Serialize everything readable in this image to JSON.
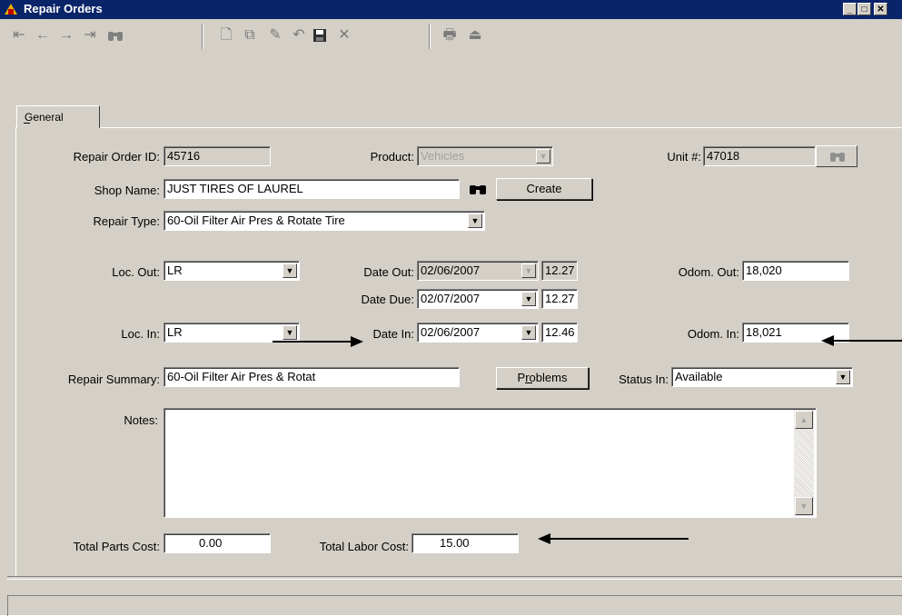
{
  "window": {
    "title": "Repair Orders"
  },
  "caption_buttons": {
    "minimize": "_",
    "maximize": "□",
    "close": "✕"
  },
  "toolbar": {
    "icons": [
      "first-record-icon",
      "previous-record-icon",
      "next-record-icon",
      "last-record-icon",
      "find-binoculars-icon",
      "new-record-icon",
      "copy-record-icon",
      "edit-pencil-icon",
      "undo-icon",
      "save-disk-icon",
      "delete-x-icon",
      "print-icon",
      "exit-icon"
    ]
  },
  "tabs": {
    "general": "General"
  },
  "form": {
    "repair_order_id": {
      "label": "Repair Order ID:",
      "value": "45716"
    },
    "product": {
      "label": "Product:",
      "value": "Vehicles"
    },
    "unit": {
      "label": "Unit #:",
      "value": "47018"
    },
    "shop_name": {
      "label": "Shop Name:",
      "value": "JUST TIRES OF LAUREL"
    },
    "create_button": "Create",
    "repair_type": {
      "label": "Repair Type:",
      "value": "60-Oil Filter Air Pres & Rotate Tire"
    },
    "loc_out": {
      "label": "Loc. Out:",
      "value": "LR"
    },
    "date_out": {
      "label": "Date Out:",
      "date": "02/06/2007",
      "time": "12.27"
    },
    "odom_out": {
      "label": "Odom. Out:",
      "value": "18,020"
    },
    "date_due": {
      "label": "Date Due:",
      "date": "02/07/2007",
      "time": "12.27"
    },
    "loc_in": {
      "label": "Loc. In:",
      "value": "LR"
    },
    "date_in": {
      "label": "Date In:",
      "date": "02/06/2007",
      "time": "12.46"
    },
    "odom_in": {
      "label": "Odom. In:",
      "value": "18,021"
    },
    "repair_summary": {
      "label": "Repair Summary:",
      "value": "60-Oil Filter Air Pres & Rotat"
    },
    "problems_button": "Problems",
    "status_in": {
      "label": "Status In:",
      "value": "Available"
    },
    "notes": {
      "label": "Notes:",
      "value": ""
    },
    "total_parts_cost": {
      "label": "Total Parts Cost:",
      "value": "0.00"
    },
    "total_labor_cost": {
      "label": "Total Labor Cost:",
      "value": "15.00"
    }
  },
  "colors": {
    "titlebar": "#0a246a",
    "face": "#d4d0c8",
    "field": "#ffffff"
  }
}
